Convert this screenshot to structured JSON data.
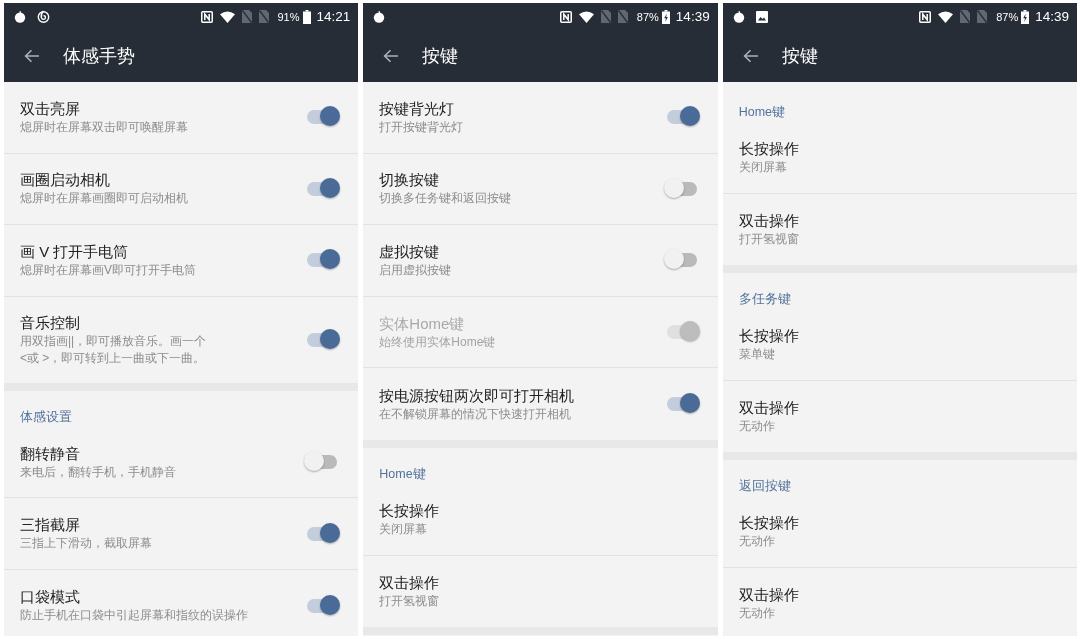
{
  "screens": [
    {
      "status_bar": {
        "notification_icons": [
          {
            "kind": "fruit"
          },
          {
            "kind": "swirl"
          }
        ],
        "battery": "91%",
        "charging": false,
        "time": "14:21"
      },
      "toolbar": {
        "title": "体感手势"
      },
      "sections": [
        {
          "rows": [
            {
              "kind": "switch",
              "title": "双击亮屏",
              "summary": "熄屏时在屏幕双击即可唤醒屏幕",
              "on": true,
              "disabled": false
            },
            {
              "kind": "switch",
              "title": "画圈启动相机",
              "summary": "熄屏时在屏幕画圈即可启动相机",
              "on": true,
              "disabled": false
            },
            {
              "kind": "switch",
              "title": "画 V 打开手电筒",
              "summary": "熄屏时在屏幕画V即可打开手电筒",
              "on": true,
              "disabled": false
            },
            {
              "kind": "switch",
              "title": "音乐控制",
              "summary": "用双指画||，即可播放音乐。画一个\n<或 >，即可转到上一曲或下一曲。",
              "on": true,
              "disabled": false
            }
          ]
        },
        {
          "header": "体感设置",
          "rows": [
            {
              "kind": "switch",
              "title": "翻转静音",
              "summary": "来电后，翻转手机，手机静音",
              "on": false,
              "disabled": false
            },
            {
              "kind": "switch",
              "title": "三指截屏",
              "summary": "三指上下滑动，截取屏幕",
              "on": true,
              "disabled": false
            },
            {
              "kind": "switch",
              "title": "口袋模式",
              "summary": "防止手机在口袋中引起屏幕和指纹的误操作",
              "on": true,
              "disabled": false
            }
          ]
        }
      ]
    },
    {
      "status_bar": {
        "notification_icons": [
          {
            "kind": "fruit"
          }
        ],
        "battery": "87%",
        "charging": true,
        "time": "14:39"
      },
      "toolbar": {
        "title": "按键"
      },
      "sections": [
        {
          "rows": [
            {
              "kind": "switch",
              "title": "按键背光灯",
              "summary": "打开按键背光灯",
              "on": true,
              "disabled": false
            },
            {
              "kind": "switch",
              "title": "切换按键",
              "summary": "切换多任务键和返回按键",
              "on": false,
              "disabled": false
            },
            {
              "kind": "switch",
              "title": "虚拟按键",
              "summary": "启用虚拟按键",
              "on": false,
              "disabled": false
            },
            {
              "kind": "switch",
              "title": "实体Home键",
              "summary": "始终使用实体Home键",
              "on": true,
              "disabled": true
            },
            {
              "kind": "switch",
              "title": "按电源按钮两次即可打开相机",
              "summary": "在不解锁屏幕的情况下快速打开相机",
              "on": true,
              "disabled": false
            }
          ]
        },
        {
          "header": "Home键",
          "rows": [
            {
              "kind": "text",
              "title": "长按操作",
              "summary": "关闭屏幕"
            },
            {
              "kind": "text",
              "title": "双击操作",
              "summary": "打开氢视窗"
            }
          ]
        }
      ]
    },
    {
      "status_bar": {
        "notification_icons": [
          {
            "kind": "fruit"
          },
          {
            "kind": "image"
          }
        ],
        "battery": "87%",
        "charging": true,
        "time": "14:39"
      },
      "toolbar": {
        "title": "按键"
      },
      "sections": [
        {
          "header": "Home键",
          "rows": [
            {
              "kind": "text",
              "title": "长按操作",
              "summary": "关闭屏幕"
            },
            {
              "kind": "text",
              "title": "双击操作",
              "summary": "打开氢视窗"
            }
          ]
        },
        {
          "header": "多任务键",
          "rows": [
            {
              "kind": "text",
              "title": "长按操作",
              "summary": "菜单键"
            },
            {
              "kind": "text",
              "title": "双击操作",
              "summary": "无动作"
            }
          ]
        },
        {
          "header": "返回按键",
          "rows": [
            {
              "kind": "text",
              "title": "长按操作",
              "summary": "无动作"
            },
            {
              "kind": "text",
              "title": "双击操作",
              "summary": "无动作"
            }
          ]
        }
      ]
    }
  ]
}
